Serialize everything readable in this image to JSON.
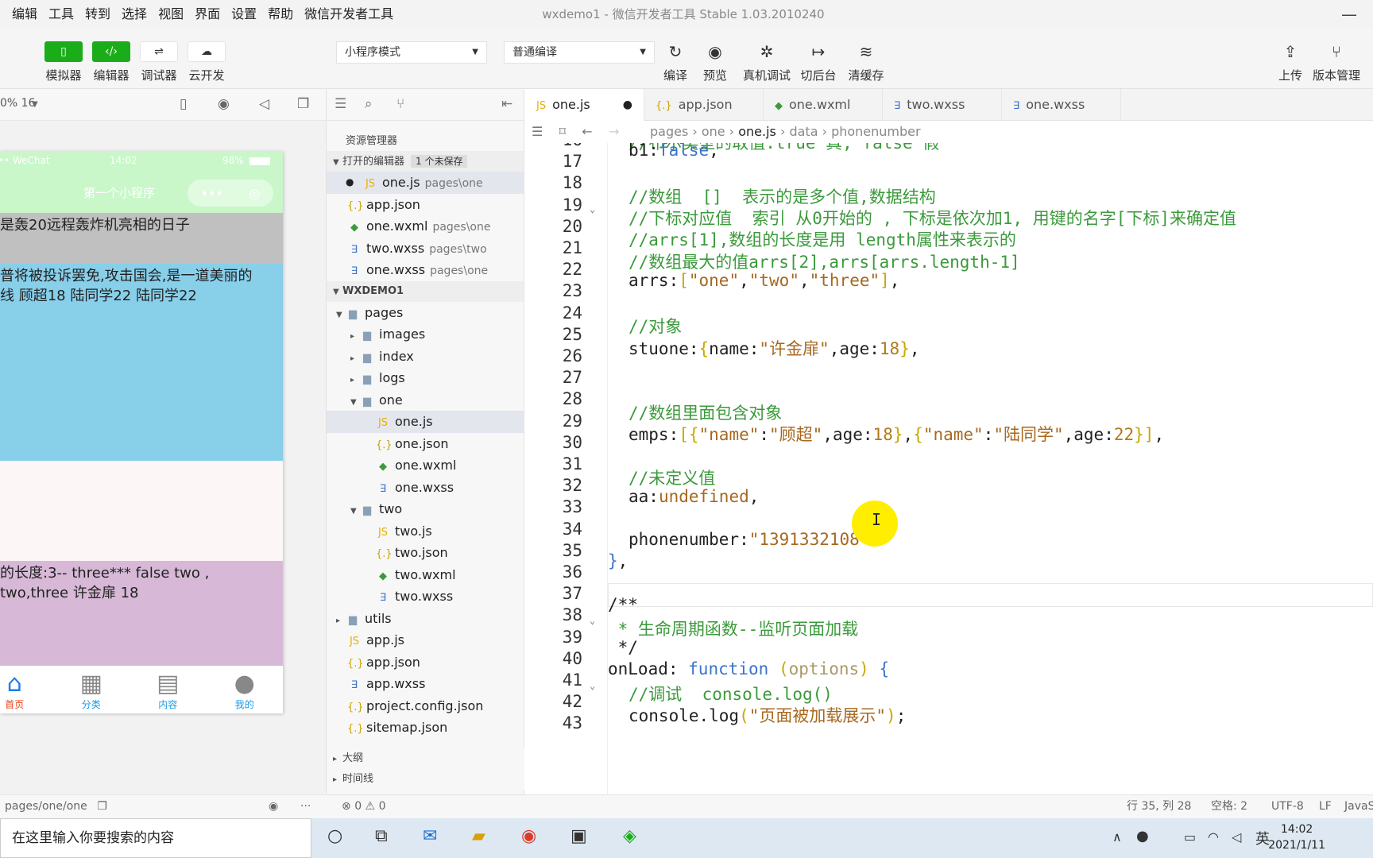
{
  "menu": [
    "编辑",
    "工具",
    "转到",
    "选择",
    "视图",
    "界面",
    "设置",
    "帮助",
    "微信开发者工具"
  ],
  "window_title": "wxdemo1 - 微信开发者工具 Stable 1.03.2010240",
  "toolbar": {
    "simulator": "模拟器",
    "editor": "编辑器",
    "debugger": "调试器",
    "cloud": "云开发",
    "mode": "小程序模式",
    "compile_mode": "普通编译",
    "compile": "编译",
    "preview": "预览",
    "real_debug": "真机调试",
    "backend": "切后台",
    "clear_cache": "清缓存",
    "upload": "上传",
    "version": "版本管理"
  },
  "simulator": {
    "zoom": "0% 16",
    "status_left": "•• WeChat",
    "status_time": "14:02",
    "status_batt": "98%",
    "nav_title": "第一个小程序",
    "block1": "是轰20远程轰炸机亮相的日子",
    "block2_l1": "普将被投诉罢免,攻击国会,是一道美丽的",
    "block2_l2": "线 顾超18 陆同学22 陆同学22",
    "block4_l1": "的长度:3-- three*** false two ,",
    "block4_l2": "two,three 许金扉 18",
    "tabs": [
      "首页",
      "分类",
      "内容",
      "我的"
    ],
    "path": "pages/one/one"
  },
  "explorer": {
    "title": "资源管理器",
    "open_editors": "打开的编辑器",
    "unsaved": "1 个未保存",
    "open_files": [
      {
        "name": "one.js",
        "path": "pages\\one",
        "type": "js",
        "dirty": true
      },
      {
        "name": "app.json",
        "path": "",
        "type": "json"
      },
      {
        "name": "one.wxml",
        "path": "pages\\one",
        "type": "wxml"
      },
      {
        "name": "two.wxss",
        "path": "pages\\two",
        "type": "wxss"
      },
      {
        "name": "one.wxss",
        "path": "pages\\one",
        "type": "wxss"
      }
    ],
    "project": "WXDEMO1",
    "tree": [
      "pages",
      "images",
      "index",
      "logs",
      "one",
      "one.js",
      "one.json",
      "one.wxml",
      "one.wxss",
      "two",
      "two.js",
      "two.json",
      "two.wxml",
      "two.wxss",
      "utils",
      "app.js",
      "app.json",
      "app.wxss",
      "project.config.json",
      "sitemap.json"
    ],
    "outline": "大纲",
    "timeline": "时间线"
  },
  "tabs": [
    {
      "name": "one.js",
      "type": "js"
    },
    {
      "name": "app.json",
      "type": "json"
    },
    {
      "name": "one.wxml",
      "type": "wxml"
    },
    {
      "name": "two.wxss",
      "type": "wxss"
    },
    {
      "name": "one.wxss",
      "type": "wxss"
    }
  ],
  "breadcrumb": [
    "pages",
    "one",
    "one.js",
    "data",
    "phonenumber"
  ],
  "code": {
    "line_numbers": [
      "16",
      "17",
      "18",
      "19",
      "20",
      "21",
      "22",
      "23",
      "24",
      "25",
      "26",
      "27",
      "28",
      "29",
      "30",
      "31",
      "32",
      "33",
      "34",
      "35",
      "36",
      "37",
      "38",
      "39",
      "40",
      "41",
      "42",
      "43"
    ],
    "l16": "//布尔类型的取值:true 真, false 假",
    "l17": "b1:false,",
    "l19": "//数组  []  表示的是多个值,数据结构",
    "l20": "//下标对应值  索引 从0开始的 , 下标是依次加1, 用键的名字[下标]来确定值",
    "l21": "//arrs[1],数组的长度是用 length属性来表示的",
    "l22": "//数组最大的值arrs[2],arrs[arrs.length-1]",
    "l23": "arrs:[\"one\",\"two\",\"three\"],",
    "l25": "//对象",
    "l26": "stuone:{name:\"许金扉\",age:18},",
    "l29": "//数组里面包含对象",
    "l30": "emps:[{\"name\":\"顾超\",age:18},{\"name\":\"陆同学\",age:22}],",
    "l32": "//未定义值",
    "l33": "aa:undefined,",
    "l35": "phonenumber:\"1391332108\"",
    "l36": "},",
    "l38": "/**",
    "l39": " * 生命周期函数--监听页面加载",
    "l40": " */",
    "l41": "onLoad: function (options) {",
    "l42": "//调试  console.log()",
    "l43": "console.log(\"页面被加载展示\");"
  },
  "status": {
    "errors": "0",
    "warnings": "0",
    "position": "行 35, 列 28",
    "spaces": "空格: 2",
    "encoding": "UTF-8",
    "eol": "LF",
    "lang": "JavaS"
  },
  "taskbar": {
    "search": "在这里输入你要搜索的内容",
    "ime": "英",
    "time": "14:02",
    "date": "2021/1/11"
  }
}
